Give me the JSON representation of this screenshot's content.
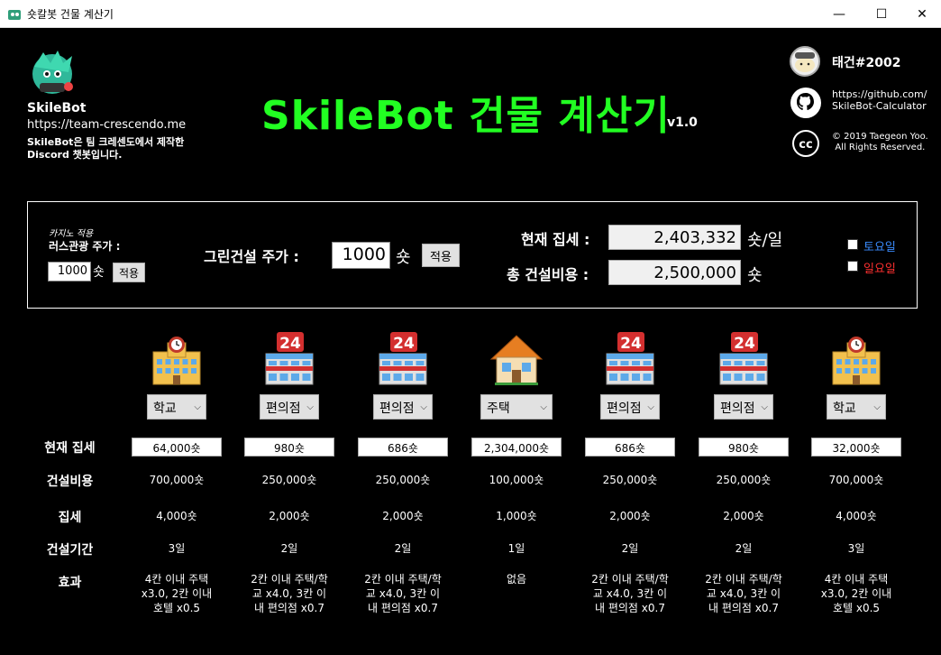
{
  "window": {
    "title": "숏칼봇 건물 계산기",
    "min_glyph": "—",
    "max_glyph": "☐",
    "close_glyph": "✕"
  },
  "bot": {
    "name": "SkileBot",
    "url": "https://team-crescendo.me",
    "description": "SkileBot은 팀 크레센도에서 제작한 Discord 챗봇입니다."
  },
  "header": {
    "title": "SkileBot 건물 계산기",
    "version": "v1.0"
  },
  "author": {
    "username": "태건#2002",
    "github_line1": "https://github.com/",
    "github_line2": "SkileBot-Calculator",
    "copyright_line1": "© 2019 Taegeon Yoo.",
    "copyright_line2": "All Rights Reserved."
  },
  "settings": {
    "casino_note": "카지노 적용",
    "tourism_label": "러스관광 주가 :",
    "tourism_value": "1000",
    "tourism_unit": "숏",
    "tourism_apply": "적용",
    "green_label": "그린건설 주가 :",
    "green_value": "1000",
    "green_unit": "숏",
    "green_apply": "적용",
    "current_rent_label": "현재 집세 :",
    "current_rent_value": "2,403,332",
    "current_rent_unit": "숏/일",
    "total_cost_label": "총 건설비용 :",
    "total_cost_value": "2,500,000",
    "total_cost_unit": "숏",
    "saturday": "토요일",
    "sunday": "일요일",
    "saturday_color": "#3a8cff",
    "sunday_color": "#ff3030"
  },
  "row_labels": {
    "current_rent": "현재 집세",
    "build_cost": "건설비용",
    "rent": "집세",
    "build_time": "건설기간",
    "effect": "효과"
  },
  "buildings": [
    {
      "icon": "school-icon",
      "type": "학교",
      "current_rent": "64,000숏",
      "build_cost": "700,000숏",
      "rent": "4,000숏",
      "build_time": "3일",
      "effect": "4칸 이내 주택 x3.0, 2칸 이내 호텔 x0.5"
    },
    {
      "icon": "convenience-store-icon",
      "type": "편의점",
      "current_rent": "980숏",
      "build_cost": "250,000숏",
      "rent": "2,000숏",
      "build_time": "2일",
      "effect": "2칸 이내 주택/학교 x4.0, 3칸 이내 편의점 x0.7"
    },
    {
      "icon": "convenience-store-icon",
      "type": "편의점",
      "current_rent": "686숏",
      "build_cost": "250,000숏",
      "rent": "2,000숏",
      "build_time": "2일",
      "effect": "2칸 이내 주택/학교 x4.0, 3칸 이내 편의점 x0.7"
    },
    {
      "icon": "house-icon",
      "type": "주택",
      "current_rent": "2,304,000숏",
      "build_cost": "100,000숏",
      "rent": "1,000숏",
      "build_time": "1일",
      "effect": "없음"
    },
    {
      "icon": "convenience-store-icon",
      "type": "편의점",
      "current_rent": "686숏",
      "build_cost": "250,000숏",
      "rent": "2,000숏",
      "build_time": "2일",
      "effect": "2칸 이내 주택/학교 x4.0, 3칸 이내 편의점 x0.7"
    },
    {
      "icon": "convenience-store-icon",
      "type": "편의점",
      "current_rent": "980숏",
      "build_cost": "250,000숏",
      "rent": "2,000숏",
      "build_time": "2일",
      "effect": "2칸 이내 주택/학교 x4.0, 3칸 이내 편의점 x0.7"
    },
    {
      "icon": "school-icon",
      "type": "학교",
      "current_rent": "32,000숏",
      "build_cost": "700,000숏",
      "rent": "4,000숏",
      "build_time": "3일",
      "effect": "4칸 이내 주택 x3.0, 2칸 이내 호텔 x0.5"
    }
  ],
  "colors": {
    "title_green": "#22ff22",
    "background": "#000000"
  }
}
